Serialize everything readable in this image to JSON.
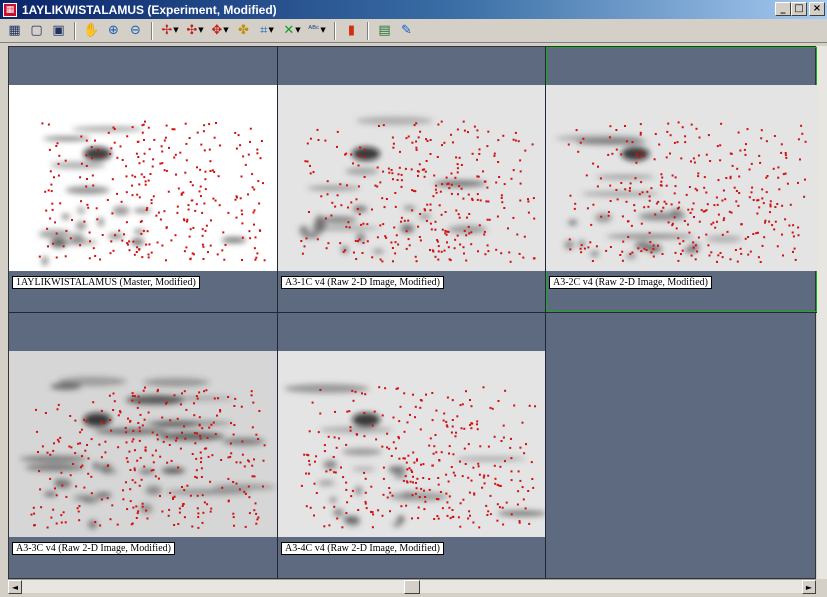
{
  "window": {
    "title": "1AYLIKWISTALAMUS (Experiment, Modified)",
    "app_icon": "gel-app-icon",
    "minimize_glyph": "_",
    "restore_glyph": "□",
    "close_glyph": "×"
  },
  "toolbar": {
    "buttons": [
      {
        "icon": "grid-layout-icon",
        "glyph": "▦"
      },
      {
        "icon": "single-view-icon",
        "glyph": "▢"
      },
      {
        "icon": "fit-view-icon",
        "glyph": "▣"
      },
      {
        "icon": "hand-pan-icon",
        "glyph": "✋"
      },
      {
        "icon": "zoom-in-icon",
        "glyph": "⊕"
      },
      {
        "icon": "zoom-out-icon",
        "glyph": "⊖"
      },
      {
        "icon": "spot-detect-icon",
        "glyph": "✢"
      },
      {
        "icon": "spot-edit-icon",
        "glyph": "✣"
      },
      {
        "icon": "spot-match-icon",
        "glyph": "✥"
      },
      {
        "icon": "match-link-icon",
        "glyph": "✤"
      },
      {
        "icon": "grid-spots-icon",
        "glyph": "⌗"
      },
      {
        "icon": "crosshair-spots-icon",
        "glyph": "✕"
      },
      {
        "icon": "spot-label-icon",
        "glyph": "ᴬᴮᶜ"
      },
      {
        "icon": "color-bars-icon",
        "glyph": "▮"
      },
      {
        "icon": "report-icon",
        "glyph": "▤"
      },
      {
        "icon": "edit-properties-icon",
        "glyph": "✎"
      }
    ]
  },
  "panels": [
    {
      "label": "1AYLIKWISTALAMUS (Master, Modified)",
      "image": "white-background-gel"
    },
    {
      "label": "A3-1C v4 (Raw 2-D Image, Modified)",
      "image": "gray-background-gel"
    },
    {
      "label": "A3-2C v4 (Raw 2-D Image, Modified)",
      "image": "gray-background-gel",
      "selected": true
    },
    {
      "label": "A3-3C v4 (Raw 2-D Image, Modified)",
      "image": "dark-streaked-gel"
    },
    {
      "label": "A3-4C v4 (Raw 2-D Image, Modified)",
      "image": "gray-background-gel"
    }
  ],
  "colors": {
    "workspace_bg": "#5e6a80",
    "spot_marker": "#d01010",
    "selected_border": "#1ea81e",
    "title_gradient_start": "#0a246a",
    "title_gradient_end": "#a6caf0"
  },
  "scrollbars": {
    "left_arrow": "◄",
    "right_arrow": "►"
  }
}
